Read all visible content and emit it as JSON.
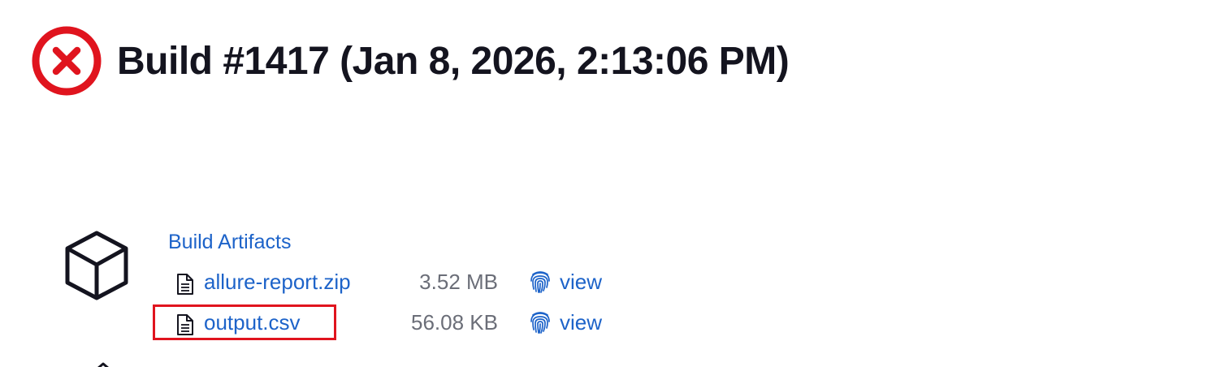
{
  "header": {
    "status_icon": "failed-x-circle-icon",
    "status_color": "#e0141e",
    "title": "Build #1417 (Jan 8, 2026, 2:13:06 PM)"
  },
  "artifacts": {
    "section_icon": "package-box-icon",
    "heading": "Build Artifacts",
    "link_color": "#1d63c9",
    "items": [
      {
        "icon": "file-document-icon",
        "name": "allure-report.zip",
        "size": "3.52 MB",
        "view_icon": "fingerprint-icon",
        "view_label": "view"
      },
      {
        "icon": "file-document-icon",
        "name": "output.csv",
        "size": "56.08 KB",
        "view_icon": "fingerprint-icon",
        "view_label": "view",
        "highlighted": true
      }
    ]
  },
  "highlight_color": "#e0141e"
}
